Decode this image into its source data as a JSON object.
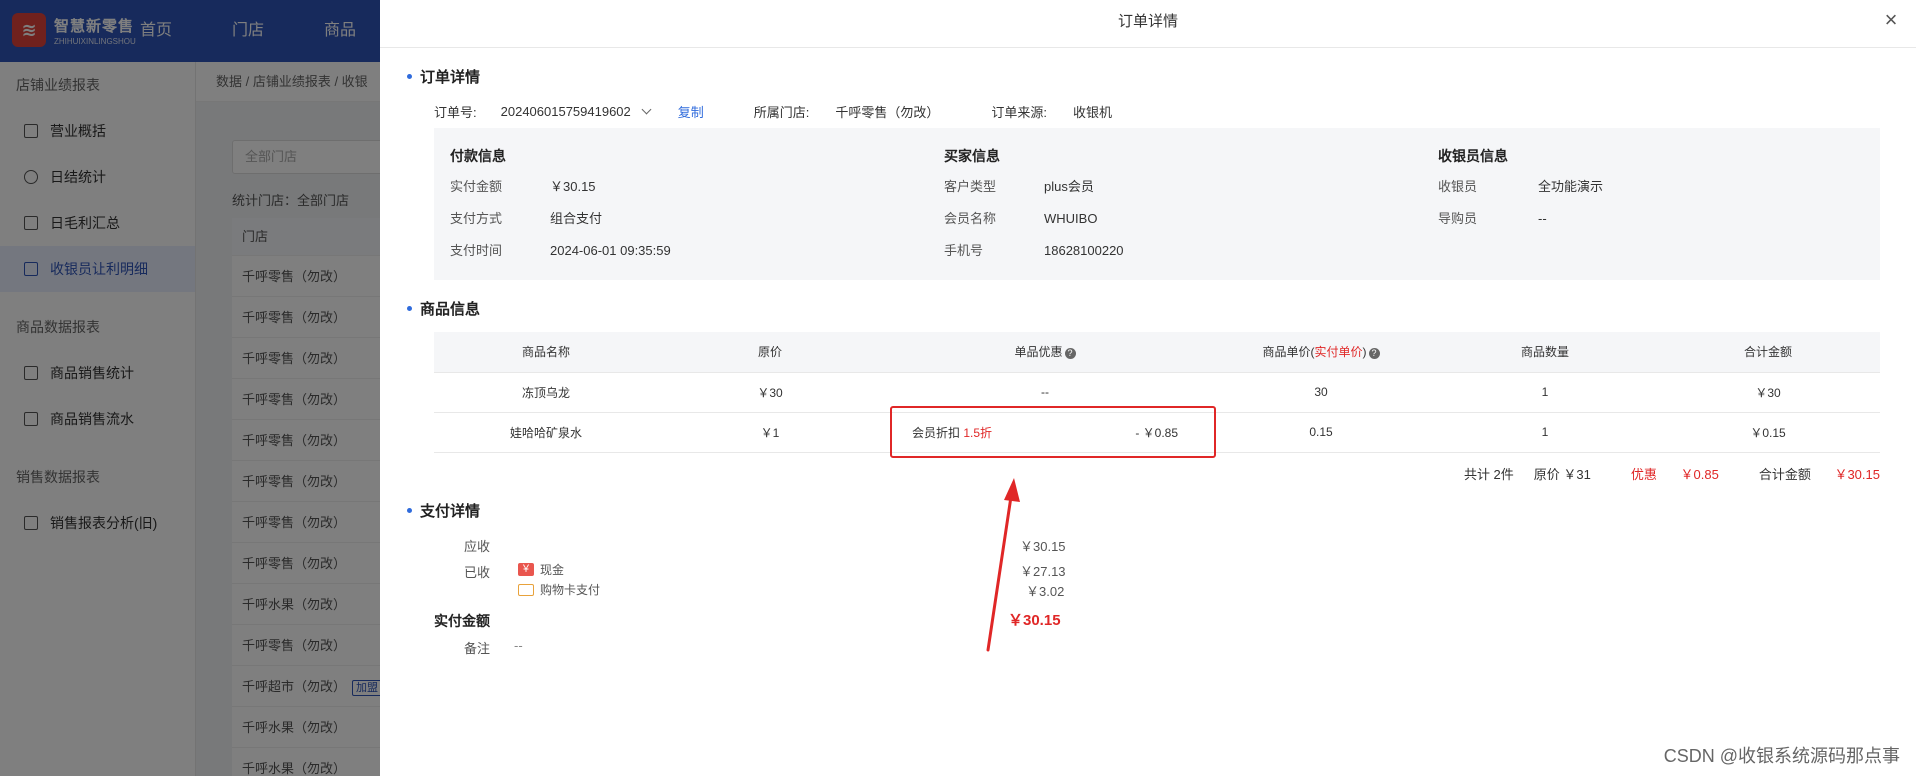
{
  "app": {
    "logo_mark": "≋",
    "logo_title": "智慧新零售",
    "logo_sub": "ZHIHUIXINLINGSHOU",
    "nav": [
      "首页",
      "门店",
      "商品"
    ]
  },
  "sidebar": {
    "group1": "店铺业绩报表",
    "items1": [
      "营业概括",
      "日结统计",
      "日毛利汇总",
      "收银员让利明细"
    ],
    "group2": "商品数据报表",
    "items2": [
      "商品销售统计",
      "商品销售流水"
    ],
    "group3": "销售数据报表",
    "items3": [
      "销售报表分析(旧)"
    ]
  },
  "background": {
    "breadcrumb": "数据 / 店铺业绩报表 / 收银",
    "filter_placeholder": "全部门店",
    "stat_label": "统计门店：",
    "stat_value": "全部门店",
    "table_head": "门店",
    "rows": [
      "千呼零售（勿改）",
      "千呼零售（勿改）",
      "千呼零售（勿改）",
      "千呼零售（勿改）",
      "千呼零售（勿改）",
      "千呼零售（勿改）",
      "千呼零售（勿改）",
      "千呼零售（勿改）",
      "千呼水果（勿改）",
      "千呼零售（勿改）",
      "千呼超市（勿改）",
      "千呼水果（勿改）",
      "千呼水果（勿改）"
    ],
    "row_badge": "加盟"
  },
  "drawer": {
    "title": "订单详情",
    "close": "×",
    "section_order": "订单详情",
    "order_no_label": "订单号:",
    "order_no": "202406015759419602",
    "copy": "复制",
    "store_label": "所属门店:",
    "store": "千呼零售（勿改）",
    "source_label": "订单来源:",
    "source": "收银机",
    "payment": {
      "title": "付款信息",
      "rows": [
        {
          "k": "实付金额",
          "v": "￥30.15"
        },
        {
          "k": "支付方式",
          "v": "组合支付"
        },
        {
          "k": "支付时间",
          "v": "2024-06-01 09:35:59"
        }
      ]
    },
    "buyer": {
      "title": "买家信息",
      "rows": [
        {
          "k": "客户类型",
          "v": "plus会员"
        },
        {
          "k": "会员名称",
          "v": "WHUIBO"
        },
        {
          "k": "手机号",
          "v": "18628100220"
        }
      ]
    },
    "cashier": {
      "title": "收银员信息",
      "rows": [
        {
          "k": "收银员",
          "v": "全功能演示"
        },
        {
          "k": "导购员",
          "v": "--"
        }
      ]
    },
    "section_goods": "商品信息",
    "goods_headers": {
      "name": "商品名称",
      "price": "原价",
      "discount": "单品优惠",
      "unit_a": "商品单价(",
      "unit_b": "实付单价",
      "unit_c": ")",
      "qty": "商品数量",
      "total": "合计金额"
    },
    "goods_rows": [
      {
        "name": "冻顶乌龙",
        "price": "￥30",
        "discount": "--",
        "unit": "30",
        "qty": "1",
        "total": "￥30"
      },
      {
        "name": "娃哈哈矿泉水",
        "price": "￥1",
        "disc_label": "会员折扣",
        "disc_rate": "1.5折",
        "disc_amount": "- ￥0.85",
        "unit": "0.15",
        "qty": "1",
        "total": "￥0.15"
      }
    ],
    "summary": {
      "count": "共计 2件",
      "orig": "原价 ￥31",
      "discount_label": "优惠",
      "discount": "￥0.85",
      "total_label": "合计金额",
      "total": "￥30.15"
    },
    "section_pay": "支付详情",
    "pay": {
      "receivable_label": "应收",
      "receivable": "￥30.15",
      "received_label": "已收",
      "cash_icon": "￥",
      "cash_label": "现金",
      "cash": "￥27.13",
      "card_label": "购物卡支付",
      "card": "￥3.02",
      "paid_label": "实付金额",
      "paid": "￥30.15",
      "remark_label": "备注",
      "remark": "--"
    }
  },
  "watermark": "CSDN @收银系统源码那点事",
  "colors": {
    "accent": "#2f6bdc",
    "danger": "#e02727",
    "nav": "#2f55b8"
  }
}
